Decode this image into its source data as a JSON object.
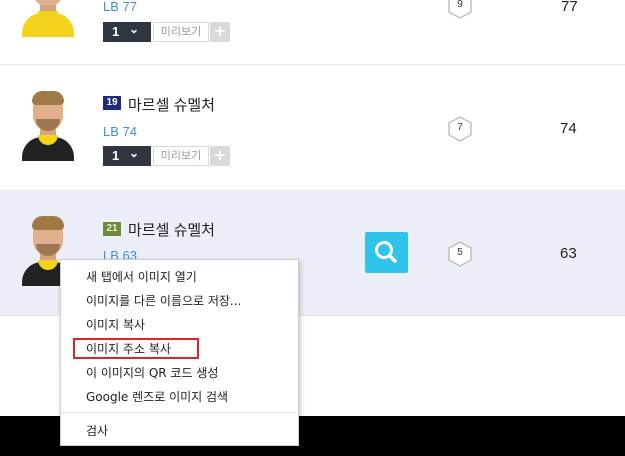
{
  "rows": [
    {
      "position_ovr": "LB 77",
      "grade": "1",
      "preview_label": "미리보기",
      "plus_label": "+",
      "level": "9",
      "ovr": "77"
    },
    {
      "season": "19",
      "name": "마르셀 슈멜처",
      "position_ovr": "LB 74",
      "grade": "1",
      "preview_label": "미리보기",
      "plus_label": "+",
      "level": "7",
      "ovr": "74"
    },
    {
      "season": "21",
      "name": "마르셀 슈멜처",
      "position_ovr": "LB 63",
      "level": "5",
      "ovr": "63"
    }
  ],
  "icons": {
    "grade_dropdown": "chevron-down-icon",
    "search": "search-icon",
    "level_badge": "hexagon-icon"
  },
  "colors": {
    "highlight_row": "#eceff8",
    "search_button": "#2fc4ec",
    "position_text": "#3c8fd9",
    "grade_select": "#2f3640",
    "menu_highlight_outline": "#e02424"
  },
  "context_menu": {
    "items": [
      "새 탭에서 이미지 열기",
      "이미지를 다른 이름으로 저장...",
      "이미지 복사",
      "이미지 주소 복사",
      "이 이미지의 QR 코드 생성",
      "Google 렌즈로 이미지 검색"
    ],
    "inspect": "검사",
    "highlighted_item": "이미지 주소 복사"
  }
}
